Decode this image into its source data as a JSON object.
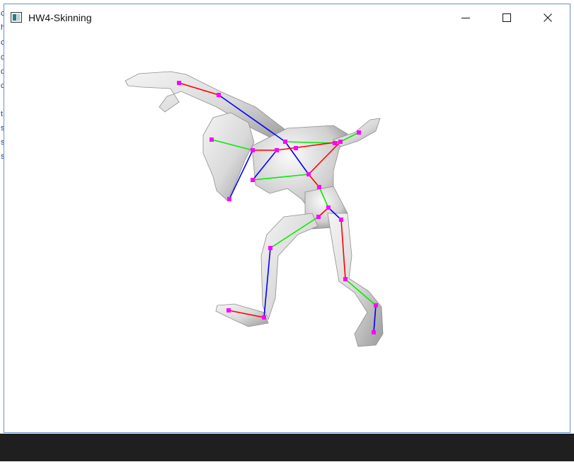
{
  "window": {
    "title": "HW4-Skinning",
    "icon": "app-window-icon",
    "controls": {
      "minimize": "minimize-icon",
      "maximize": "maximize-icon",
      "close": "close-icon"
    }
  },
  "background": {
    "strip_glyphs": [
      "c",
      "h",
      "c",
      "c",
      "d",
      "c",
      "t",
      "s",
      "s",
      "s"
    ]
  },
  "colors": {
    "window_border": "#6b8fc4",
    "bone_red": "#ff0000",
    "bone_green": "#00ee00",
    "bone_blue": "#0000ff",
    "joint": "#ff00ff",
    "taskbar": "#1f1f1f"
  }
}
